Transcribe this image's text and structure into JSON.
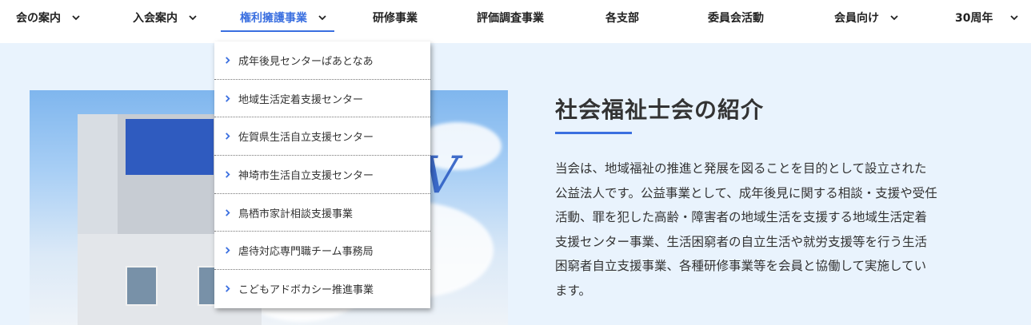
{
  "nav": {
    "items": [
      {
        "label": "会の案内",
        "has_dropdown": true,
        "active": false
      },
      {
        "label": "入会案内",
        "has_dropdown": true,
        "active": false
      },
      {
        "label": "権利擁護事業",
        "has_dropdown": true,
        "active": true
      },
      {
        "label": "研修事業",
        "has_dropdown": false,
        "active": false
      },
      {
        "label": "評価調査事業",
        "has_dropdown": false,
        "active": false
      },
      {
        "label": "各支部",
        "has_dropdown": false,
        "active": false
      },
      {
        "label": "委員会活動",
        "has_dropdown": false,
        "active": false
      },
      {
        "label": "会員向け",
        "has_dropdown": true,
        "active": false
      },
      {
        "label": "30周年",
        "has_dropdown": true,
        "active": false
      }
    ]
  },
  "dropdown": {
    "items": [
      {
        "label": "成年後見センターぱあとなあ"
      },
      {
        "label": "地域生活定着支援センター"
      },
      {
        "label": "佐賀県生活自立支援センター"
      },
      {
        "label": "神埼市生活自立支援センター"
      },
      {
        "label": "鳥栖市家計相談支援事業"
      },
      {
        "label": "虐待対応専門職チーム事務局"
      },
      {
        "label": "こどもアドボカシー推進事業"
      }
    ]
  },
  "hero": {
    "partial_letter": "V"
  },
  "intro": {
    "title": "社会福祉士会の紹介",
    "body": "当会は、地域福祉の推進と発展を図ることを目的として設立された公益法人です。公益事業として、成年後見に関する相談・支援や受任活動、罪を犯した高齢・障害者の地域生活を支援する地域生活定着支援センター事業、生活困窮者の自立生活や就労支援等を行う生活困窮者自立支援事業、各種研修事業等を会員と協働して実施しています。"
  },
  "colors": {
    "accent": "#3a6fe0",
    "background": "#e9f3fd",
    "text": "#333333"
  }
}
